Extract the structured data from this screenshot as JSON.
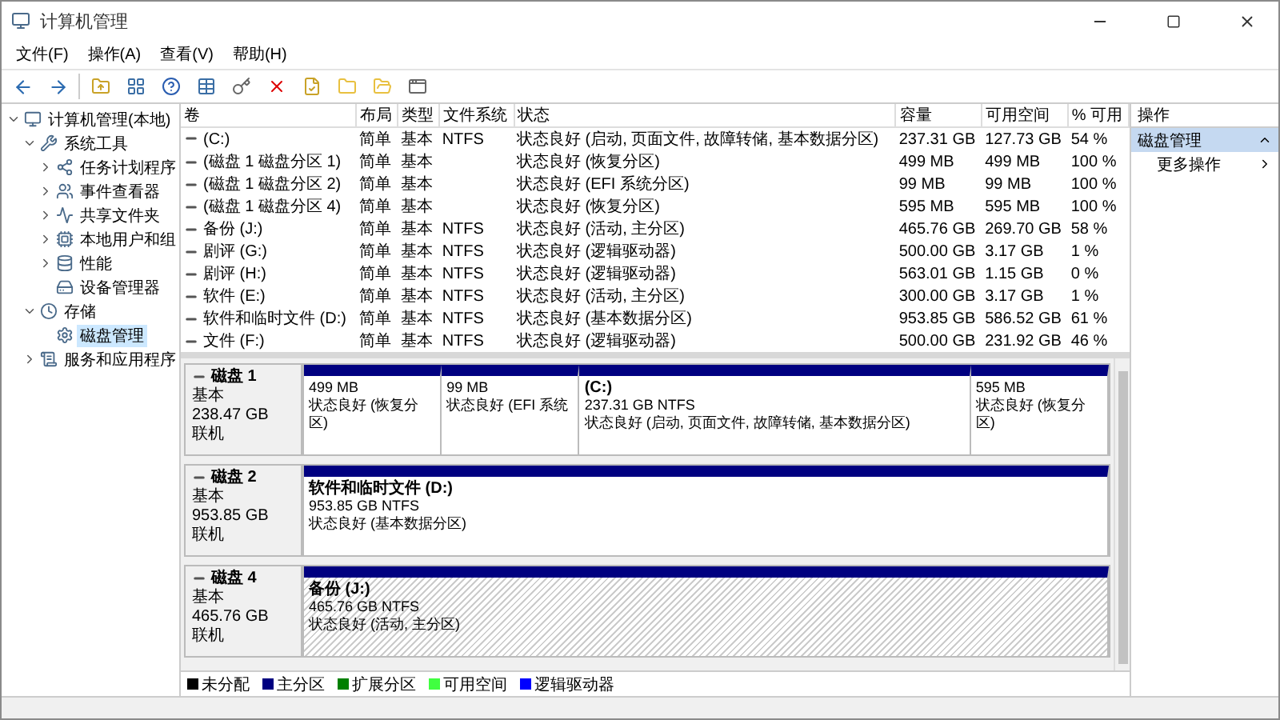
{
  "window": {
    "title": "计算机管理"
  },
  "menu": [
    "文件(F)",
    "操作(A)",
    "查看(V)",
    "帮助(H)"
  ],
  "tree": [
    {
      "label": "计算机管理(本地)",
      "selected": false,
      "expanded": true,
      "children": [
        {
          "label": "系统工具",
          "selected": false,
          "expanded": true,
          "children": [
            {
              "label": "任务计划程序",
              "selected": false,
              "expanded": false
            },
            {
              "label": "事件查看器",
              "selected": false,
              "expanded": false
            },
            {
              "label": "共享文件夹",
              "selected": false,
              "expanded": false
            },
            {
              "label": "本地用户和组",
              "selected": false,
              "expanded": false
            },
            {
              "label": "性能",
              "selected": false,
              "expanded": false
            },
            {
              "label": "设备管理器",
              "selected": false
            }
          ]
        },
        {
          "label": "存储",
          "selected": false,
          "expanded": true,
          "children": [
            {
              "label": "磁盘管理",
              "selected": true
            }
          ]
        },
        {
          "label": "服务和应用程序",
          "selected": false,
          "expanded": false
        }
      ]
    }
  ],
  "volumes": {
    "columns": [
      "卷",
      "布局",
      "类型",
      "文件系统",
      "状态",
      "容量",
      "可用空间",
      "% 可用"
    ],
    "rows": [
      [
        "(C:)",
        "简单",
        "基本",
        "NTFS",
        "状态良好 (启动, 页面文件, 故障转储, 基本数据分区)",
        "237.31 GB",
        "127.73 GB",
        "54 %"
      ],
      [
        "(磁盘 1 磁盘分区 1)",
        "简单",
        "基本",
        "",
        "状态良好 (恢复分区)",
        "499 MB",
        "499 MB",
        "100 %"
      ],
      [
        "(磁盘 1 磁盘分区 2)",
        "简单",
        "基本",
        "",
        "状态良好 (EFI 系统分区)",
        "99 MB",
        "99 MB",
        "100 %"
      ],
      [
        "(磁盘 1 磁盘分区 4)",
        "简单",
        "基本",
        "",
        "状态良好 (恢复分区)",
        "595 MB",
        "595 MB",
        "100 %"
      ],
      [
        "备份 (J:)",
        "简单",
        "基本",
        "NTFS",
        "状态良好 (活动, 主分区)",
        "465.76 GB",
        "269.70 GB",
        "58 %"
      ],
      [
        "剧评 (G:)",
        "简单",
        "基本",
        "NTFS",
        "状态良好 (逻辑驱动器)",
        "500.00 GB",
        "3.17 GB",
        "1 %"
      ],
      [
        "剧评 (H:)",
        "简单",
        "基本",
        "NTFS",
        "状态良好 (逻辑驱动器)",
        "563.01 GB",
        "1.15 GB",
        "0 %"
      ],
      [
        "软件 (E:)",
        "简单",
        "基本",
        "NTFS",
        "状态良好 (活动, 主分区)",
        "300.00 GB",
        "3.17 GB",
        "1 %"
      ],
      [
        "软件和临时文件 (D:)",
        "简单",
        "基本",
        "NTFS",
        "状态良好 (基本数据分区)",
        "953.85 GB",
        "586.52 GB",
        "61 %"
      ],
      [
        "文件 (F:)",
        "简单",
        "基本",
        "NTFS",
        "状态良好 (逻辑驱动器)",
        "500.00 GB",
        "231.92 GB",
        "46 %"
      ]
    ]
  },
  "disks": [
    {
      "name": "磁盘 1",
      "type": "基本",
      "size": "238.47 GB",
      "status": "联机",
      "partitions": [
        {
          "kind": "primary",
          "selected": false,
          "size": "499 MB",
          "status": "状态良好 (恢复分区)"
        },
        {
          "kind": "primary",
          "selected": false,
          "size": "99 MB",
          "status": "状态良好 (EFI 系统"
        },
        {
          "kind": "primary",
          "selected": false,
          "label": "(C:)",
          "size": "237.31 GB NTFS",
          "status": "状态良好 (启动, 页面文件, 故障转储, 基本数据分区)"
        },
        {
          "kind": "primary",
          "selected": false,
          "size": "595 MB",
          "status": "状态良好 (恢复分区)"
        }
      ]
    },
    {
      "name": "磁盘 2",
      "type": "基本",
      "size": "953.85 GB",
      "status": "联机",
      "partitions": [
        {
          "kind": "primary",
          "selected": false,
          "label": "软件和临时文件  (D:)",
          "size": "953.85 GB NTFS",
          "status": "状态良好 (基本数据分区)"
        }
      ]
    },
    {
      "name": "磁盘 4",
      "type": "基本",
      "size": "465.76 GB",
      "status": "联机",
      "partitions": [
        {
          "kind": "primary",
          "selected": true,
          "label": "备份  (J:)",
          "size": "465.76 GB NTFS",
          "status": "状态良好 (活动, 主分区)"
        }
      ]
    }
  ],
  "legend": [
    {
      "label": "未分配",
      "color": "#000000"
    },
    {
      "label": "主分区",
      "color": "#000080"
    },
    {
      "label": "扩展分区",
      "color": "#008000"
    },
    {
      "label": "可用空间",
      "color": "#40ff40"
    },
    {
      "label": "逻辑驱动器",
      "color": "#0000ff"
    }
  ],
  "actions": {
    "title": "操作",
    "section": {
      "label": "磁盘管理",
      "expanded": true
    },
    "items": [
      "更多操作"
    ]
  }
}
